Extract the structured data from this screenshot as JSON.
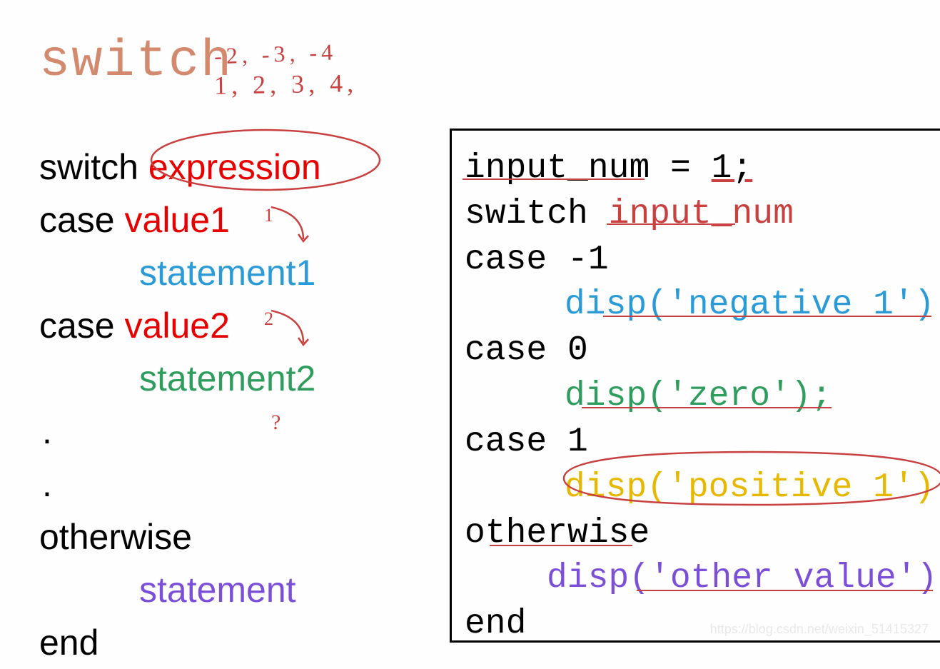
{
  "title": "switch",
  "handwritten_top": {
    "row1": "-2, -3, -4",
    "row2": "1, 2, 3, 4,"
  },
  "syntax": {
    "line1_kw": "switch",
    "line1_expr": "expression",
    "line2_kw": "case",
    "line2_val": "value1",
    "line2_sub": "1",
    "line3": "statement1",
    "line4_kw": "case",
    "line4_val": "value2",
    "line4_sub": "2",
    "line5": "statement2",
    "dot": ".",
    "line7": "otherwise",
    "line8": "statement",
    "line9": "end",
    "qmark": "?"
  },
  "code": {
    "l1a": "input_num = ",
    "l1b": "1;",
    "l2a": "switch ",
    "l2b": "input_num",
    "l3": "case -1",
    "l4": "disp('negative 1')",
    "l5": "case 0",
    "l6": "disp('zero');",
    "l7": "case 1",
    "l8": "disp('positive 1')",
    "l9": "otherwise",
    "l10": "disp('other value')",
    "l11": "end"
  },
  "watermark": "https://blog.csdn.net/weixin_51415327"
}
